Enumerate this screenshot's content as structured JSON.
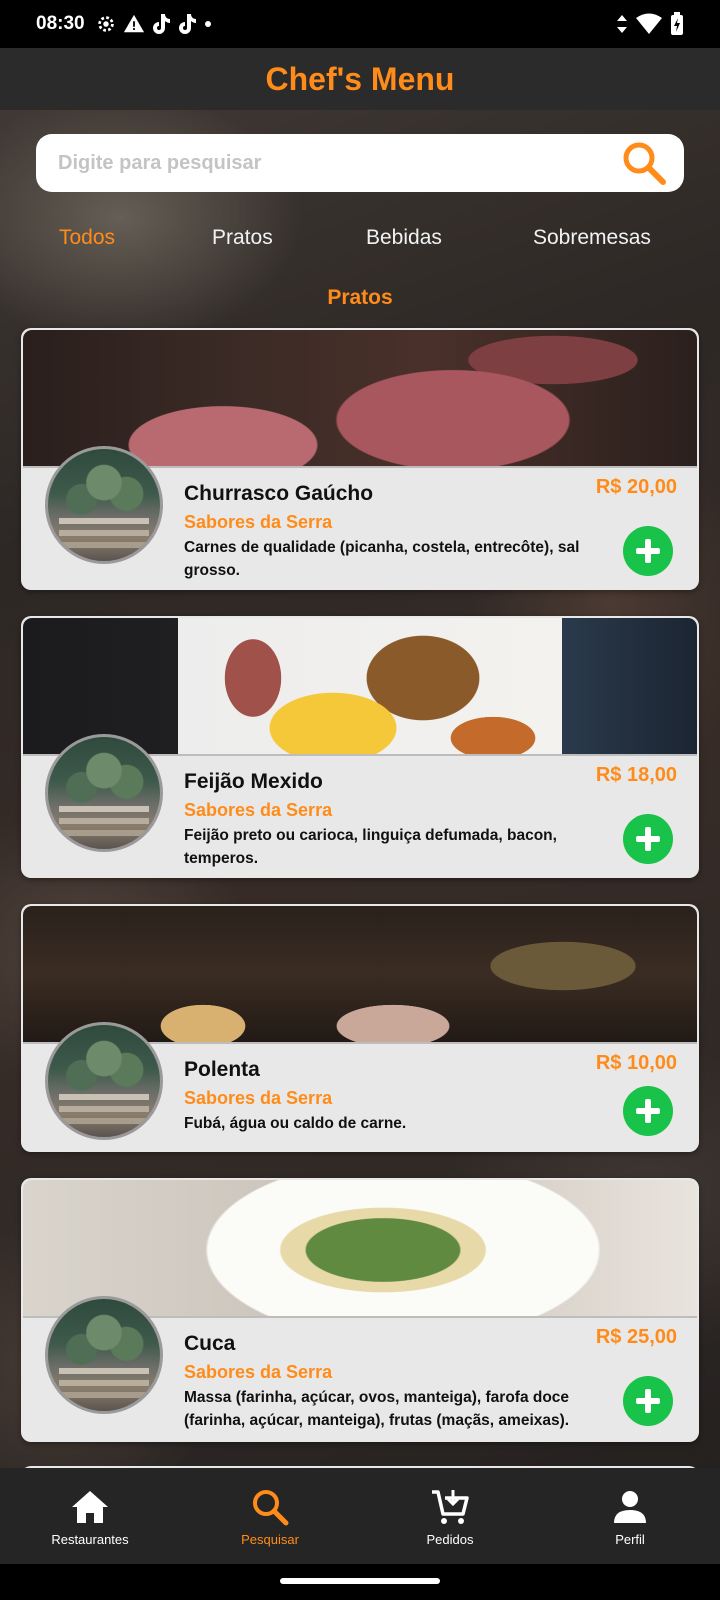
{
  "status_bar": {
    "time": "08:30"
  },
  "app": {
    "title": "Chef's Menu"
  },
  "search": {
    "placeholder": "Digite para pesquisar",
    "value": ""
  },
  "tabs": [
    {
      "label": "Todos",
      "active": true
    },
    {
      "label": "Pratos",
      "active": false
    },
    {
      "label": "Bebidas",
      "active": false
    },
    {
      "label": "Sobremesas",
      "active": false
    }
  ],
  "section": {
    "title": "Pratos"
  },
  "dishes": [
    {
      "name": "Churrasco Gaúcho",
      "restaurant": "Sabores da Serra",
      "description": "Carnes de qualidade (picanha, costela, entrecôte), sal grosso.",
      "price": "R$ 20,00"
    },
    {
      "name": "Feijão Mexido",
      "restaurant": "Sabores da Serra",
      "description": "Feijão preto ou carioca, linguiça defumada, bacon, temperos.",
      "price": "R$ 18,00"
    },
    {
      "name": "Polenta",
      "restaurant": "Sabores da Serra",
      "description": "Fubá, água ou caldo de carne.",
      "price": "R$ 10,00"
    },
    {
      "name": "Cuca",
      "restaurant": "Sabores da Serra",
      "description": "Massa (farinha, açúcar, ovos, manteiga), farofa doce (farinha, açúcar, manteiga), frutas (maçãs, ameixas).",
      "price": "R$ 25,00"
    }
  ],
  "bottom_nav": [
    {
      "label": "Restaurantes",
      "icon": "home-icon",
      "active": false
    },
    {
      "label": "Pesquisar",
      "icon": "search-icon",
      "active": true
    },
    {
      "label": "Pedidos",
      "icon": "cart-icon",
      "active": false
    },
    {
      "label": "Perfil",
      "icon": "person-icon",
      "active": false
    }
  ],
  "colors": {
    "accent": "#ff8c1a",
    "add_button": "#19c249",
    "card_bg": "#e8e8e8",
    "app_bar": "#2b2b2b"
  }
}
